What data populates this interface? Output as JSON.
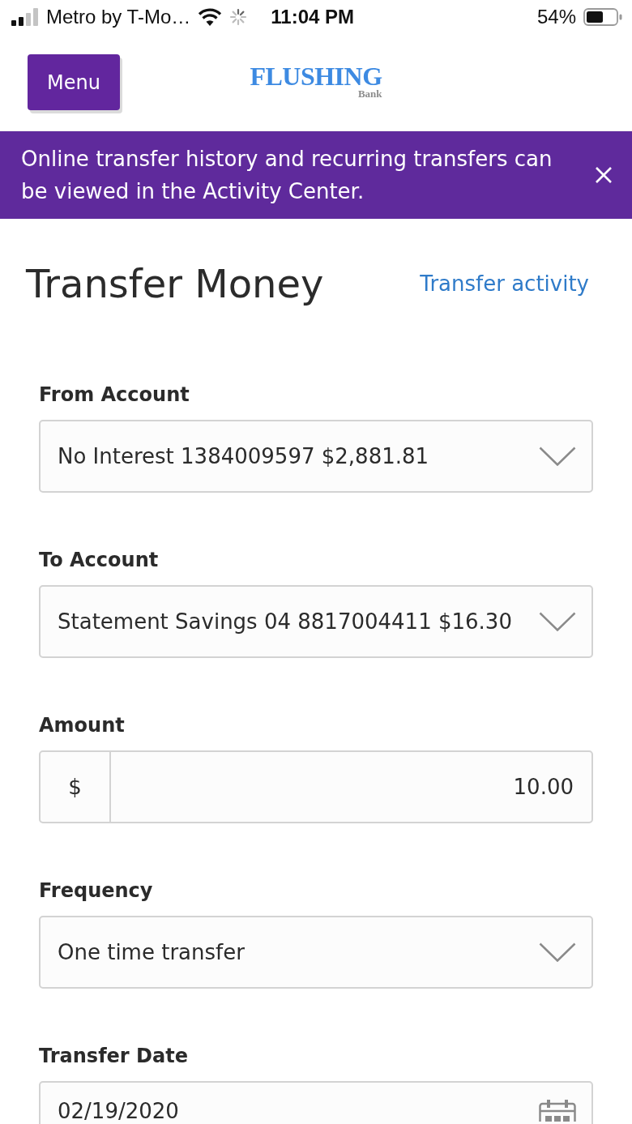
{
  "status_bar": {
    "carrier": "Metro by T-Mo…",
    "time": "11:04 PM",
    "battery": "54%"
  },
  "header": {
    "menu_button": "Menu",
    "logo": {
      "name": "FLUSHING",
      "sub": "Bank"
    }
  },
  "banner": {
    "message": "Online transfer history and recurring transfers can be viewed in the Activity Center."
  },
  "page": {
    "title": "Transfer Money",
    "link": "Transfer activity"
  },
  "fields": [
    {
      "kind": "select",
      "label": "From Account",
      "value": "No Interest 1384009597 $2,881.81"
    },
    {
      "kind": "select",
      "label": "To Account",
      "value": "Statement Savings 04 8817004411 $16.30"
    },
    {
      "kind": "amount",
      "label": "Amount",
      "prefix": "$",
      "value": "10.00"
    },
    {
      "kind": "select",
      "label": "Frequency",
      "value": "One time transfer"
    },
    {
      "kind": "date",
      "label": "Transfer Date",
      "value": "02/19/2020"
    }
  ]
}
